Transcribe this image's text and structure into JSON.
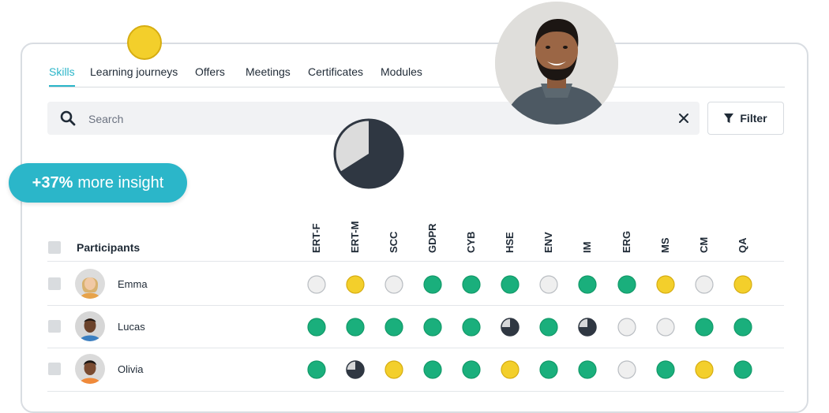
{
  "tabs": [
    {
      "label": "Skills",
      "active": true
    },
    {
      "label": "Learning journeys",
      "active": false
    },
    {
      "label": "Offers",
      "active": false
    },
    {
      "label": "Meetings",
      "active": false
    },
    {
      "label": "Certificates",
      "active": false
    },
    {
      "label": "Modules",
      "active": false
    }
  ],
  "search": {
    "placeholder": "Search",
    "value": ""
  },
  "filter": {
    "label": "Filter"
  },
  "insight": {
    "value": "+37%",
    "text": "more insight"
  },
  "pie_fraction": 0.66,
  "table": {
    "participants_header": "Participants",
    "columns": [
      "ERT-F",
      "ERT-M",
      "SCC",
      "GDPR",
      "CYB",
      "HSE",
      "ENV",
      "IM",
      "ERG",
      "MS",
      "CM",
      "QA"
    ],
    "rows": [
      {
        "name": "Emma",
        "status": [
          "empty",
          "yellow",
          "empty",
          "green",
          "green",
          "green",
          "empty",
          "green",
          "green",
          "yellow",
          "empty",
          "yellow"
        ]
      },
      {
        "name": "Lucas",
        "status": [
          "green",
          "green",
          "green",
          "green",
          "green",
          "partial",
          "green",
          "partial",
          "empty",
          "empty",
          "green",
          "green"
        ]
      },
      {
        "name": "Olivia",
        "status": [
          "green",
          "partial",
          "yellow",
          "green",
          "green",
          "yellow",
          "green",
          "green",
          "empty",
          "green",
          "yellow",
          "green"
        ]
      }
    ]
  },
  "colors": {
    "accent": "#2bb6c9",
    "green": "#1aaf7c",
    "yellow": "#f3cf2b",
    "empty": "#efefef",
    "dark": "#2f3742"
  }
}
